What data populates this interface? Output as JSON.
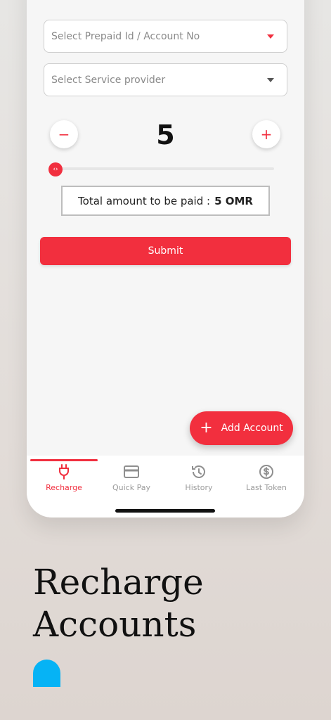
{
  "form": {
    "account_placeholder": "Select Prepaid Id / Account No",
    "provider_placeholder": "Select Service provider",
    "quantity": "5",
    "minus_label": "−",
    "plus_label": "+",
    "slider_fraction": 0.0,
    "total_label": "Total amount to be paid :",
    "total_amount": "5 OMR",
    "submit_label": "Submit"
  },
  "fab": {
    "label": "Add Account",
    "icon": "plus-icon"
  },
  "tabs": [
    {
      "label": "Recharge",
      "icon": "plug-icon",
      "active": true
    },
    {
      "label": "Quick Pay",
      "icon": "card-icon",
      "active": false
    },
    {
      "label": "History",
      "icon": "history-icon",
      "active": false
    },
    {
      "label": "Last Token",
      "icon": "dollar-icon",
      "active": false
    }
  ],
  "promo": {
    "line1": "Recharge",
    "line2": "Accounts"
  },
  "colors": {
    "accent": "#f22f3e",
    "blob": "#06b3f5",
    "caret_provider": "#555555"
  }
}
